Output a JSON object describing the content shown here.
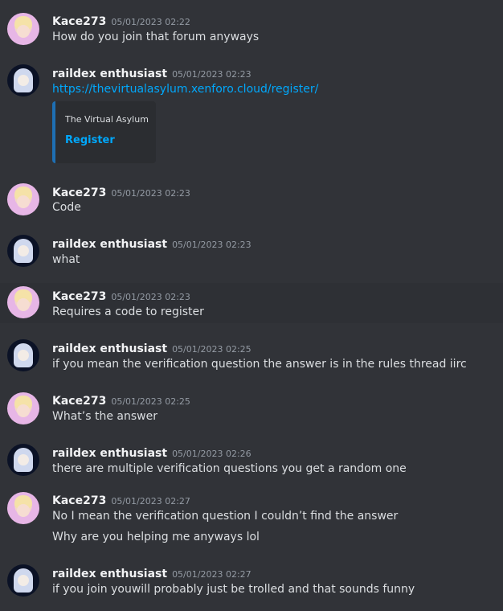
{
  "messages": [
    {
      "author": "Kace273",
      "timestamp": "05/01/2023 02:22",
      "text": "How do you join that forum anyways"
    },
    {
      "author": "raildex enthusiast",
      "timestamp": "05/01/2023 02:23",
      "link": "https://thevirtualasylum.xenforo.cloud/register/",
      "embed": {
        "provider": "The Virtual Asylum",
        "title": "Register"
      }
    },
    {
      "author": "Kace273",
      "timestamp": "05/01/2023 02:23",
      "text": "Code"
    },
    {
      "author": "raildex enthusiast",
      "timestamp": "05/01/2023 02:23",
      "text": "what"
    },
    {
      "author": "Kace273",
      "timestamp": "05/01/2023 02:23",
      "text": "Requires a code to register"
    },
    {
      "author": "raildex enthusiast",
      "timestamp": "05/01/2023 02:25",
      "text": "if you mean the verification question the answer is in the rules thread iirc"
    },
    {
      "author": "Kace273",
      "timestamp": "05/01/2023 02:25",
      "text": "What’s the answer"
    },
    {
      "author": "raildex enthusiast",
      "timestamp": "05/01/2023 02:26",
      "text": "there are multiple verification questions you get a random one"
    },
    {
      "author": "Kace273",
      "timestamp": "05/01/2023 02:27",
      "text": "No I mean the verification question I couldn’t find the answer",
      "text2": "Why are you helping me anyways lol"
    },
    {
      "author": "raildex enthusiast",
      "timestamp": "05/01/2023 02:27",
      "text": "if you join youwill probably just be trolled and that sounds funny"
    }
  ]
}
